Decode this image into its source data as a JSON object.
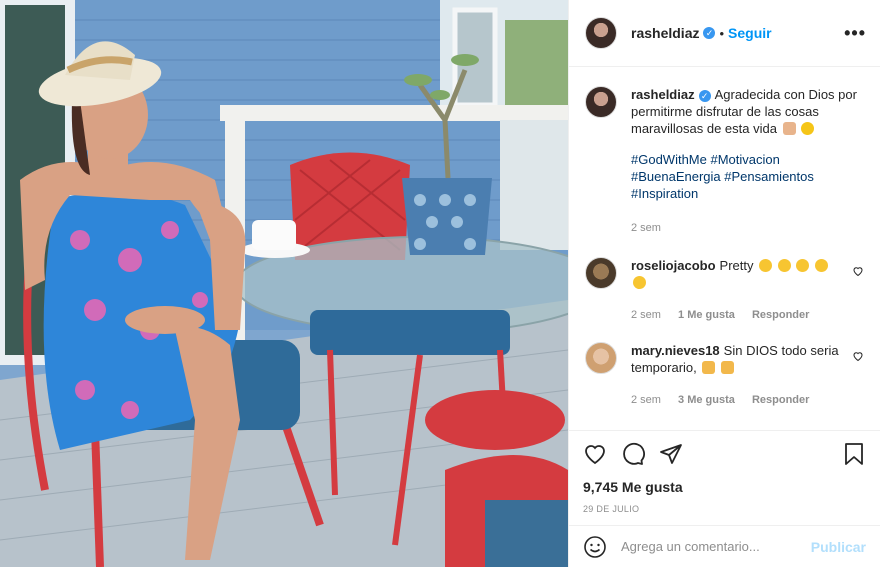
{
  "header": {
    "username": "rasheldiaz",
    "separator": "•",
    "follow_label": "Seguir",
    "more_label": "•••"
  },
  "caption": {
    "username": "rasheldiaz",
    "text": "Agradecida con Dios por permitirme disfrutar de las cosas maravillosas de esta vida",
    "hashtags": [
      "#GodWithMe",
      "#Motivacion",
      "#BuenaEnergia",
      "#Pensamientos",
      "#Inspiration"
    ],
    "time": "2 sem"
  },
  "comments": [
    {
      "username": "roseliojacobo",
      "text": "Pretty",
      "time": "2 sem",
      "likes": "1 Me gusta",
      "reply": "Responder"
    },
    {
      "username": "mary.nieves18",
      "text": "Sin DIOS todo seria temporario,",
      "time": "2 sem",
      "likes": "3 Me gusta",
      "reply": "Responder"
    }
  ],
  "actions": {
    "likes": "9,745 Me gusta",
    "date": "29 DE JULIO"
  },
  "add_comment": {
    "placeholder": "Agrega un comentario...",
    "publish_label": "Publicar"
  },
  "colors": {
    "accent": "#0095f6",
    "verified": "#3897f0",
    "hashtag": "#00376b",
    "muted": "#8e8e8e",
    "publish_disabled": "#b2dffc"
  },
  "icons": [
    "verified-icon",
    "more-options-icon",
    "heart-icon",
    "comment-icon",
    "share-icon",
    "bookmark-icon",
    "emoji-icon"
  ]
}
